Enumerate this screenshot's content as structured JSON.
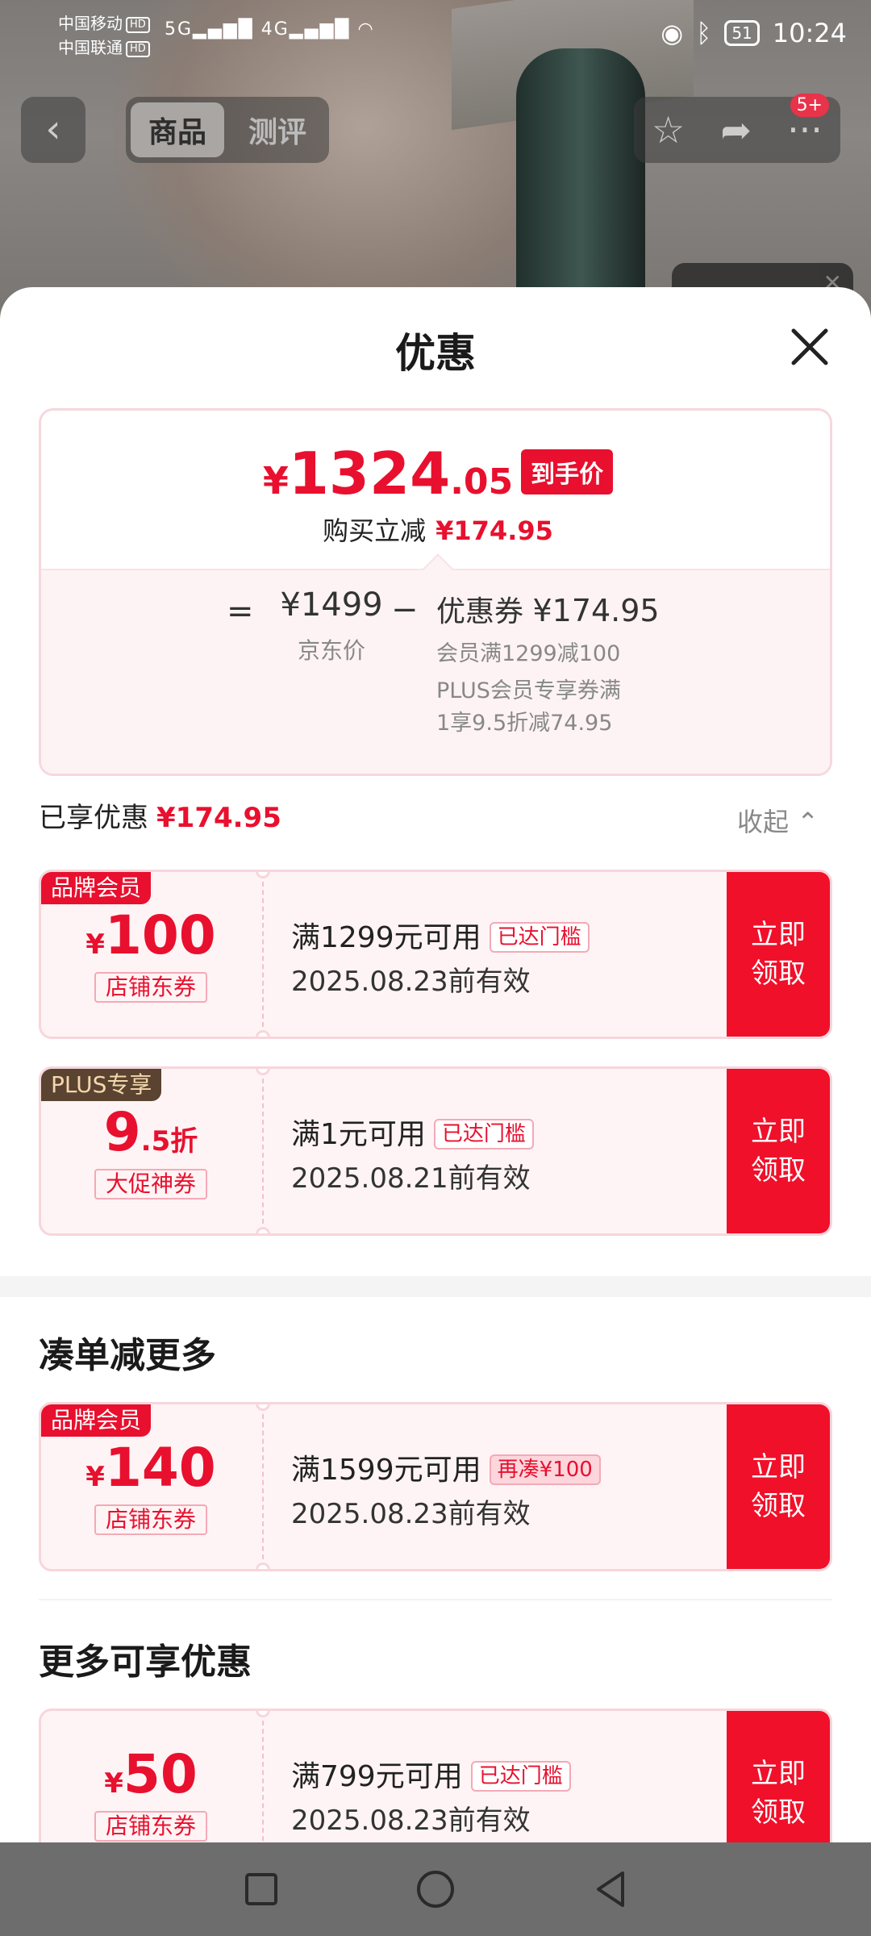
{
  "status_bar": {
    "carrier1": "中国移动",
    "carrier2": "中国联通",
    "hd": "HD",
    "net1": "5G",
    "net2": "4G",
    "battery": "51",
    "time": "10:24"
  },
  "top_nav": {
    "tabs": [
      "商品",
      "测评"
    ],
    "badge": "5+"
  },
  "sheet": {
    "title": "优惠",
    "summary": {
      "price_symbol": "¥",
      "price_int": "1324",
      "price_dec": ".05",
      "price_tag": "到手价",
      "save_label": "购买立减",
      "save_amount": "¥174.95",
      "equals": "=",
      "jd_price": "¥1499",
      "jd_label": "京东价",
      "minus": "−",
      "coupon_label": "优惠券",
      "coupon_amount": "¥174.95",
      "detail1": "会员满1299减100",
      "detail2": "PLUS会员专享券满",
      "detail3": "1享9.5折减74.95"
    },
    "enjoyed_label": "已享优惠",
    "enjoyed_amount": "¥174.95",
    "collapse_label": "收起",
    "coupons": [
      {
        "tag": "品牌会员",
        "symbol": "¥",
        "amount": "100",
        "suffix": "",
        "kind": "店铺东券",
        "condition": "满1299元可用",
        "badge": "已达门槛",
        "date": "2025.08.23前有效",
        "button": "立即领取"
      },
      {
        "tag": "PLUS专享",
        "symbol": "",
        "amount": "9",
        "suffix": ".5折",
        "kind": "大促神券",
        "condition": "满1元可用",
        "badge": "已达门槛",
        "date": "2025.08.21前有效",
        "button": "立即领取"
      }
    ],
    "section2_title": "凑单减更多",
    "coupon3": {
      "tag": "品牌会员",
      "symbol": "¥",
      "amount": "140",
      "kind": "店铺东券",
      "condition": "满1599元可用",
      "badge": "再凑¥100",
      "date": "2025.08.23前有效",
      "button": "立即领取"
    },
    "section3_title": "更多可享优惠",
    "coupon4": {
      "symbol": "¥",
      "amount": "50",
      "kind": "店铺东券",
      "condition": "满799元可用",
      "badge": "已达门槛",
      "date": "2025.08.23前有效",
      "button": "立即领取"
    }
  },
  "colors": {
    "accent": "#e8102e",
    "coupon_bg": "#fff4f5",
    "plus_tag": "#5a4330"
  }
}
